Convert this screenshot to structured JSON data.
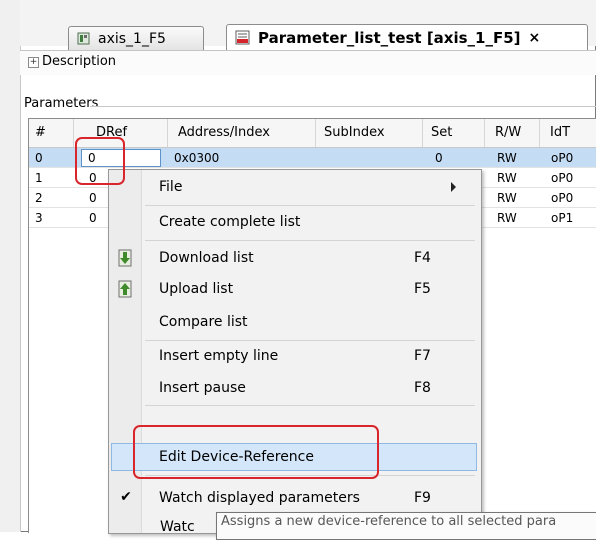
{
  "tabs": [
    {
      "label": "axis_1_F5",
      "icon": "device-icon",
      "active": false
    },
    {
      "label": "Parameter_list_test [axis_1_F5]",
      "icon": "kebab-list-icon",
      "active": true,
      "close": "×"
    }
  ],
  "description": {
    "toggle": "+",
    "label": "Description"
  },
  "parameters": {
    "label": "Parameters",
    "columns": [
      "#",
      "DRef",
      "Address/Index",
      "SubIndex",
      "Set",
      "R/W",
      "IdT"
    ],
    "rows": [
      {
        "num": "0",
        "dref": "0",
        "address": "0x0300",
        "set": "0",
        "rw": "RW",
        "idt": "oP0"
      },
      {
        "num": "1",
        "dref": "0",
        "rw": "RW",
        "idt": "oP0"
      },
      {
        "num": "2",
        "dref": "0",
        "rw": "RW",
        "idt": "oP0"
      },
      {
        "num": "3",
        "dref": "0",
        "rw": "RW",
        "idt": "oP1"
      }
    ]
  },
  "menu": {
    "items": [
      {
        "label": "File",
        "has_submenu": true
      },
      {
        "label": "Create complete list"
      },
      {
        "label": "Download list",
        "shortcut": "F4",
        "icon": "download-arrow-icon"
      },
      {
        "label": "Upload list",
        "shortcut": "F5",
        "icon": "upload-arrow-icon"
      },
      {
        "label": "Compare list"
      },
      {
        "label": "Insert empty line",
        "shortcut": "F7"
      },
      {
        "label": "Insert pause",
        "shortcut": "F8"
      },
      {
        "label": "Edit Device-Reference",
        "highlighted": true
      },
      {
        "label": "Watch displayed parameters",
        "shortcut": "F9",
        "checked": true
      },
      {
        "label": "Watc"
      }
    ]
  },
  "tooltip": "Assigns a new device-reference to all selected para",
  "colors": {
    "selection": "#c4dcf4",
    "highlight": "#d4e7fa",
    "annotation_red": "#d9262d"
  }
}
